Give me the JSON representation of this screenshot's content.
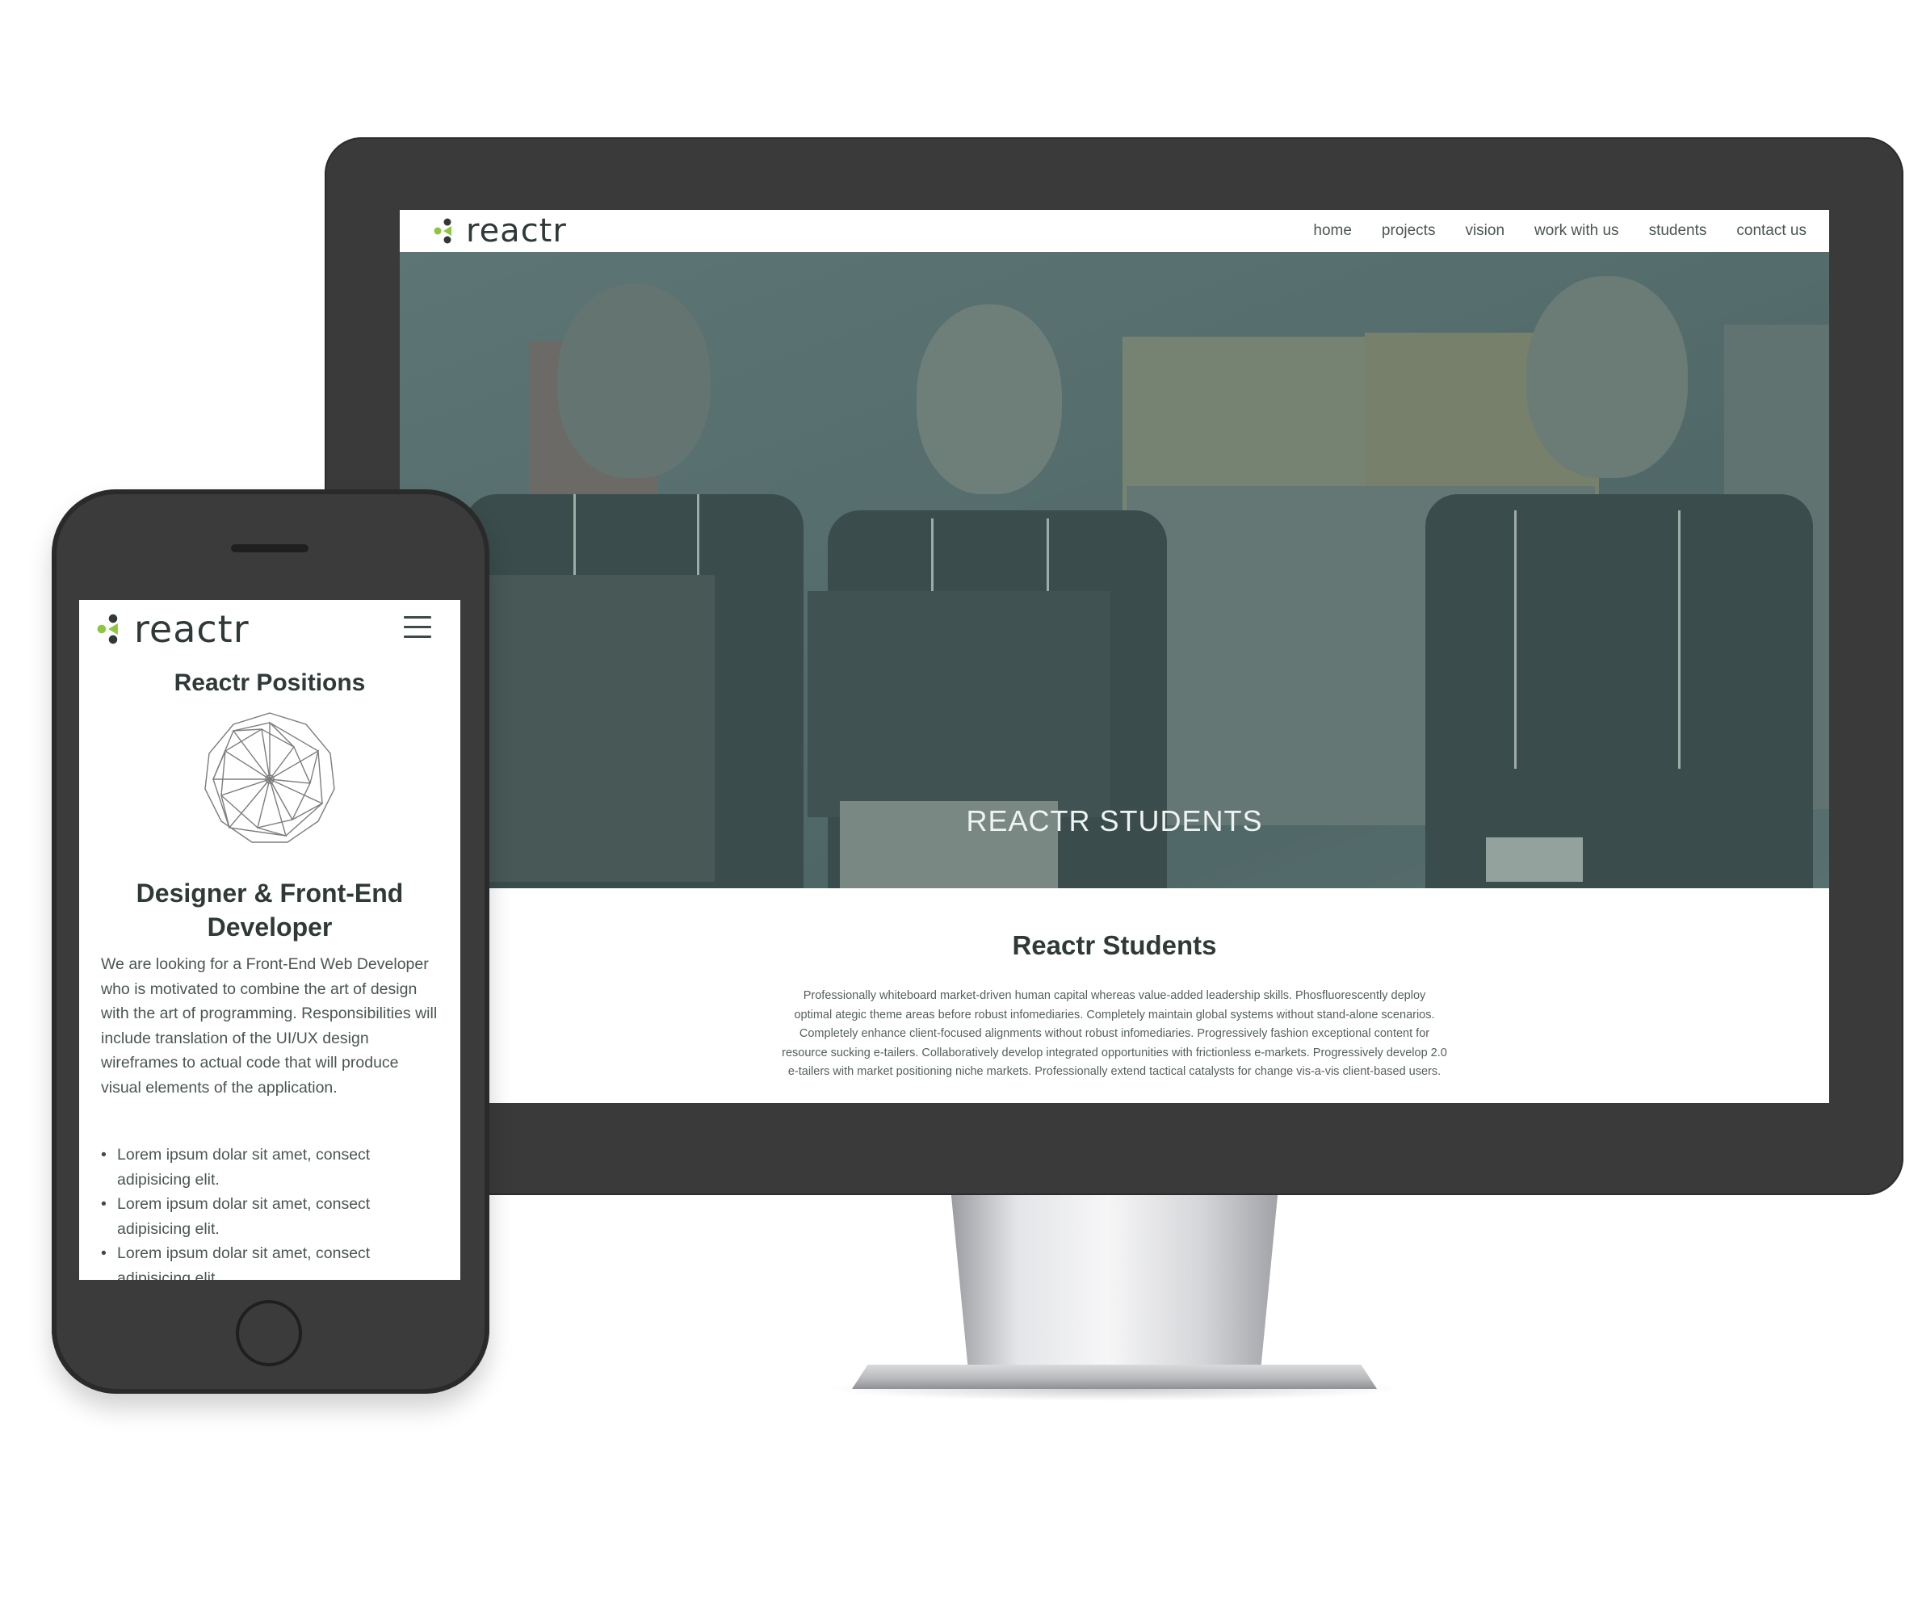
{
  "brand": {
    "name": "reactr",
    "colors": {
      "green": "#8dc63f",
      "dark": "#2f3a38",
      "device": "#3a3a3a"
    }
  },
  "desktop": {
    "nav": {
      "items": [
        "home",
        "projects",
        "vision",
        "work with us",
        "students",
        "contact us"
      ]
    },
    "hero": {
      "title": "REACTR STUDENTS"
    },
    "section": {
      "heading": "Reactr Students",
      "paragraph_lines": [
        "Professionally whiteboard market-driven human capital whereas value-added leadership skills. Phosfluorescently deploy",
        "optimal ategic theme areas before robust infomediaries. Completely maintain global systems without stand-alone scenarios.",
        "Completely enhance client-focused alignments without robust infomediaries. Progressively fashion exceptional content for",
        "resource sucking e-tailers. Collaboratively develop integrated opportunities with frictionless e-markets. Progressively develop 2.0",
        "e-tailers with market positioning niche markets. Professionally extend tactical catalysts for change vis-a-vis client-based users."
      ]
    }
  },
  "mobile": {
    "menu_icon": "hamburger-icon",
    "title": "Reactr Positions",
    "job_title": "Designer & Front-End Developer",
    "description": "We are looking for a Front-End Web Developer who is motivated to combine the art of design with the art of programming. Responsibilities will include translation of the UI/UX design wireframes to actual code that will produce visual elements of the application.",
    "bullets": [
      "Lorem ipsum dolar sit amet, consect adipisicing elit.",
      "Lorem ipsum dolar sit amet, consect adipisicing elit.",
      "Lorem ipsum dolar sit amet, consect adipisicing elit."
    ]
  }
}
